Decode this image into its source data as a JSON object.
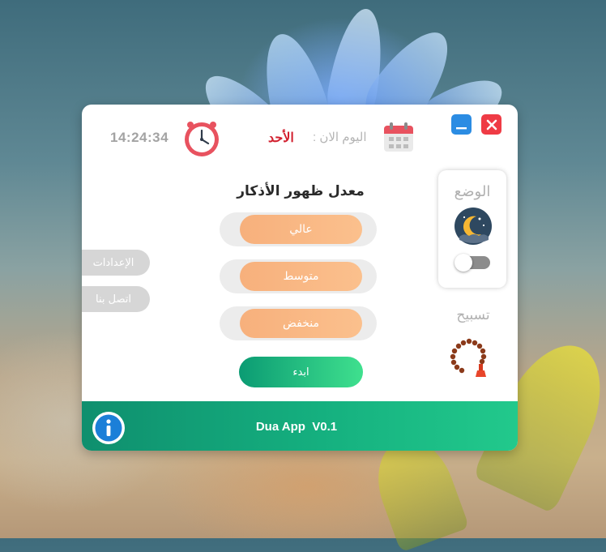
{
  "header": {
    "time": "14:24:34",
    "day": "الأحد",
    "today_label": "اليوم الان :"
  },
  "main": {
    "heading": "معدل ظهور الأذكار",
    "options": [
      "عالي",
      "متوسط",
      "منخفض"
    ],
    "start_label": "ابدء"
  },
  "side_tabs": {
    "settings": "الإعدادات",
    "contact": "اتصل بنا"
  },
  "mode": {
    "label": "الوضع",
    "icon": "moon-night-icon",
    "toggle_on": false
  },
  "tasbih": {
    "label": "تسبيح",
    "icon": "prayer-beads-icon"
  },
  "footer": {
    "version": "Dua App  V0.1"
  },
  "colors": {
    "accent_green": "#15b07f",
    "option_orange": "#f7b07c",
    "day_red": "#d2202f",
    "close_red": "#ef3b45",
    "minimize_blue": "#2b8ce3"
  }
}
